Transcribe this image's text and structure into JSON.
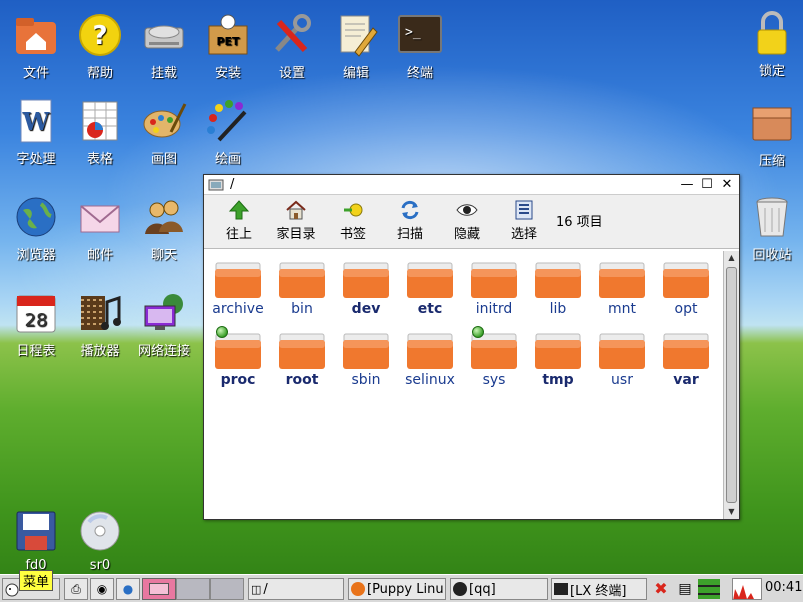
{
  "desktop": {
    "icons": [
      {
        "label": "文件"
      },
      {
        "label": "帮助"
      },
      {
        "label": "挂载"
      },
      {
        "label": "安装"
      },
      {
        "label": "设置"
      },
      {
        "label": "编辑"
      },
      {
        "label": "终端"
      },
      {
        "label": "锁定"
      },
      {
        "label": "字处理"
      },
      {
        "label": "表格"
      },
      {
        "label": "画图"
      },
      {
        "label": "绘画"
      },
      {
        "label": "压缩"
      },
      {
        "label": "浏览器"
      },
      {
        "label": "邮件"
      },
      {
        "label": "聊天"
      },
      {
        "label": "回收站"
      },
      {
        "label": "日程表"
      },
      {
        "label": "播放器"
      },
      {
        "label": "网络连接"
      },
      {
        "label": "fd0"
      },
      {
        "label": "sr0"
      }
    ],
    "calendar_day": "28",
    "pet_text": "PET"
  },
  "window": {
    "title": "/",
    "toolbar": {
      "up": "往上",
      "home": "家目录",
      "bookmarks": "书签",
      "scan": "扫描",
      "hide": "隐藏",
      "select": "选择",
      "count": "16 项目"
    },
    "folders": [
      {
        "name": "archive"
      },
      {
        "name": "bin"
      },
      {
        "name": "dev"
      },
      {
        "name": "etc"
      },
      {
        "name": "initrd"
      },
      {
        "name": "lib"
      },
      {
        "name": "mnt"
      },
      {
        "name": "opt"
      },
      {
        "name": "proc"
      },
      {
        "name": "root"
      },
      {
        "name": "sbin"
      },
      {
        "name": "selinux"
      },
      {
        "name": "sys"
      },
      {
        "name": "tmp"
      },
      {
        "name": "usr"
      },
      {
        "name": "var"
      }
    ]
  },
  "taskbar": {
    "menu": "菜单",
    "tasks": [
      {
        "label": "/"
      },
      {
        "label": "[Puppy Linu"
      },
      {
        "label": "[qq]"
      },
      {
        "label": "[LX 终端]"
      }
    ],
    "clock": "00:41"
  },
  "colors": {
    "folder": "#f0782e",
    "accent_green": "#3da12b"
  }
}
